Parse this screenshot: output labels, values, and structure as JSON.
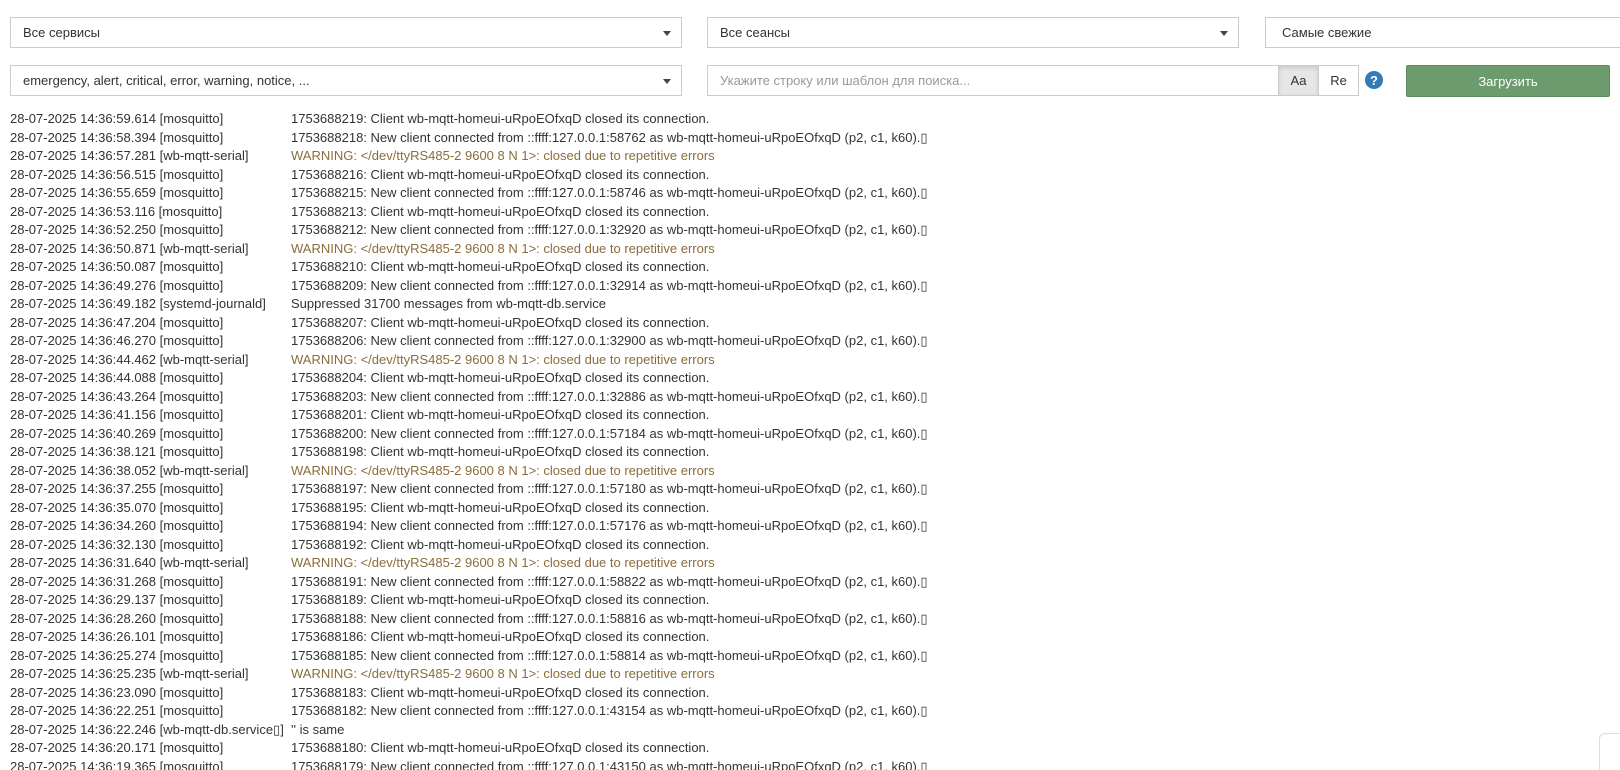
{
  "filters": {
    "services": "Все сервисы",
    "sessions": "Все сеансы",
    "order": "Самые свежие",
    "levels": "emergency, alert, critical, error, warning, notice, ..."
  },
  "search": {
    "placeholder": "Укажите строку или шаблон для поиска...",
    "case_label": "Aa",
    "regex_label": "Re",
    "help": "?"
  },
  "load_button": "Загрузить",
  "log": [
    {
      "meta": "28-07-2025 14:36:59.614 [mosquitto]",
      "msg": "1753688219: Client wb-mqtt-homeui-uRpoEOfxqD closed its connection.",
      "level": "info"
    },
    {
      "meta": "28-07-2025 14:36:58.394 [mosquitto]",
      "msg": "1753688218: New client connected from ::ffff:127.0.0.1:58762 as wb-mqtt-homeui-uRpoEOfxqD (p2, c1, k60).▯",
      "level": "info"
    },
    {
      "meta": "28-07-2025 14:36:57.281 [wb-mqtt-serial]",
      "msg": "WARNING: </dev/ttyRS485-2 9600 8 N 1>: closed due to repetitive errors",
      "level": "warning"
    },
    {
      "meta": "28-07-2025 14:36:56.515 [mosquitto]",
      "msg": "1753688216: Client wb-mqtt-homeui-uRpoEOfxqD closed its connection.",
      "level": "info"
    },
    {
      "meta": "28-07-2025 14:36:55.659 [mosquitto]",
      "msg": "1753688215: New client connected from ::ffff:127.0.0.1:58746 as wb-mqtt-homeui-uRpoEOfxqD (p2, c1, k60).▯",
      "level": "info"
    },
    {
      "meta": "28-07-2025 14:36:53.116 [mosquitto]",
      "msg": "1753688213: Client wb-mqtt-homeui-uRpoEOfxqD closed its connection.",
      "level": "info"
    },
    {
      "meta": "28-07-2025 14:36:52.250 [mosquitto]",
      "msg": "1753688212: New client connected from ::ffff:127.0.0.1:32920 as wb-mqtt-homeui-uRpoEOfxqD (p2, c1, k60).▯",
      "level": "info"
    },
    {
      "meta": "28-07-2025 14:36:50.871 [wb-mqtt-serial]",
      "msg": "WARNING: </dev/ttyRS485-2 9600 8 N 1>: closed due to repetitive errors",
      "level": "warning"
    },
    {
      "meta": "28-07-2025 14:36:50.087 [mosquitto]",
      "msg": "1753688210: Client wb-mqtt-homeui-uRpoEOfxqD closed its connection.",
      "level": "info"
    },
    {
      "meta": "28-07-2025 14:36:49.276 [mosquitto]",
      "msg": "1753688209: New client connected from ::ffff:127.0.0.1:32914 as wb-mqtt-homeui-uRpoEOfxqD (p2, c1, k60).▯",
      "level": "info"
    },
    {
      "meta": "28-07-2025 14:36:49.182 [systemd-journald]",
      "msg": "Suppressed 31700 messages from wb-mqtt-db.service",
      "level": "info"
    },
    {
      "meta": "28-07-2025 14:36:47.204 [mosquitto]",
      "msg": "1753688207: Client wb-mqtt-homeui-uRpoEOfxqD closed its connection.",
      "level": "info"
    },
    {
      "meta": "28-07-2025 14:36:46.270 [mosquitto]",
      "msg": "1753688206: New client connected from ::ffff:127.0.0.1:32900 as wb-mqtt-homeui-uRpoEOfxqD (p2, c1, k60).▯",
      "level": "info"
    },
    {
      "meta": "28-07-2025 14:36:44.462 [wb-mqtt-serial]",
      "msg": "WARNING: </dev/ttyRS485-2 9600 8 N 1>: closed due to repetitive errors",
      "level": "warning"
    },
    {
      "meta": "28-07-2025 14:36:44.088 [mosquitto]",
      "msg": "1753688204: Client wb-mqtt-homeui-uRpoEOfxqD closed its connection.",
      "level": "info"
    },
    {
      "meta": "28-07-2025 14:36:43.264 [mosquitto]",
      "msg": "1753688203: New client connected from ::ffff:127.0.0.1:32886 as wb-mqtt-homeui-uRpoEOfxqD (p2, c1, k60).▯",
      "level": "info"
    },
    {
      "meta": "28-07-2025 14:36:41.156 [mosquitto]",
      "msg": "1753688201: Client wb-mqtt-homeui-uRpoEOfxqD closed its connection.",
      "level": "info"
    },
    {
      "meta": "28-07-2025 14:36:40.269 [mosquitto]",
      "msg": "1753688200: New client connected from ::ffff:127.0.0.1:57184 as wb-mqtt-homeui-uRpoEOfxqD (p2, c1, k60).▯",
      "level": "info"
    },
    {
      "meta": "28-07-2025 14:36:38.121 [mosquitto]",
      "msg": "1753688198: Client wb-mqtt-homeui-uRpoEOfxqD closed its connection.",
      "level": "info"
    },
    {
      "meta": "28-07-2025 14:36:38.052 [wb-mqtt-serial]",
      "msg": "WARNING: </dev/ttyRS485-2 9600 8 N 1>: closed due to repetitive errors",
      "level": "warning"
    },
    {
      "meta": "28-07-2025 14:36:37.255 [mosquitto]",
      "msg": "1753688197: New client connected from ::ffff:127.0.0.1:57180 as wb-mqtt-homeui-uRpoEOfxqD (p2, c1, k60).▯",
      "level": "info"
    },
    {
      "meta": "28-07-2025 14:36:35.070 [mosquitto]",
      "msg": "1753688195: Client wb-mqtt-homeui-uRpoEOfxqD closed its connection.",
      "level": "info"
    },
    {
      "meta": "28-07-2025 14:36:34.260 [mosquitto]",
      "msg": "1753688194: New client connected from ::ffff:127.0.0.1:57176 as wb-mqtt-homeui-uRpoEOfxqD (p2, c1, k60).▯",
      "level": "info"
    },
    {
      "meta": "28-07-2025 14:36:32.130 [mosquitto]",
      "msg": "1753688192: Client wb-mqtt-homeui-uRpoEOfxqD closed its connection.",
      "level": "info"
    },
    {
      "meta": "28-07-2025 14:36:31.640 [wb-mqtt-serial]",
      "msg": "WARNING: </dev/ttyRS485-2 9600 8 N 1>: closed due to repetitive errors",
      "level": "warning"
    },
    {
      "meta": "28-07-2025 14:36:31.268 [mosquitto]",
      "msg": "1753688191: New client connected from ::ffff:127.0.0.1:58822 as wb-mqtt-homeui-uRpoEOfxqD (p2, c1, k60).▯",
      "level": "info"
    },
    {
      "meta": "28-07-2025 14:36:29.137 [mosquitto]",
      "msg": "1753688189: Client wb-mqtt-homeui-uRpoEOfxqD closed its connection.",
      "level": "info"
    },
    {
      "meta": "28-07-2025 14:36:28.260 [mosquitto]",
      "msg": "1753688188: New client connected from ::ffff:127.0.0.1:58816 as wb-mqtt-homeui-uRpoEOfxqD (p2, c1, k60).▯",
      "level": "info"
    },
    {
      "meta": "28-07-2025 14:36:26.101 [mosquitto]",
      "msg": "1753688186: Client wb-mqtt-homeui-uRpoEOfxqD closed its connection.",
      "level": "info"
    },
    {
      "meta": "28-07-2025 14:36:25.274 [mosquitto]",
      "msg": "1753688185: New client connected from ::ffff:127.0.0.1:58814 as wb-mqtt-homeui-uRpoEOfxqD (p2, c1, k60).▯",
      "level": "info"
    },
    {
      "meta": "28-07-2025 14:36:25.235 [wb-mqtt-serial]",
      "msg": "WARNING: </dev/ttyRS485-2 9600 8 N 1>: closed due to repetitive errors",
      "level": "warning"
    },
    {
      "meta": "28-07-2025 14:36:23.090 [mosquitto]",
      "msg": "1753688183: Client wb-mqtt-homeui-uRpoEOfxqD closed its connection.",
      "level": "info"
    },
    {
      "meta": "28-07-2025 14:36:22.251 [mosquitto]",
      "msg": "1753688182: New client connected from ::ffff:127.0.0.1:43154 as wb-mqtt-homeui-uRpoEOfxqD (p2, c1, k60).▯",
      "level": "info"
    },
    {
      "meta": "28-07-2025 14:36:22.246 [wb-mqtt-db.service▯]",
      "msg": "'' is same",
      "level": "info"
    },
    {
      "meta": "28-07-2025 14:36:20.171 [mosquitto]",
      "msg": "1753688180: Client wb-mqtt-homeui-uRpoEOfxqD closed its connection.",
      "level": "info"
    },
    {
      "meta": "28-07-2025 14:36:19.365 [mosquitto]",
      "msg": "1753688179: New client connected from ::ffff:127.0.0.1:43150 as wb-mqtt-homeui-uRpoEOfxqD (p2, c1, k60).▯",
      "level": "info"
    }
  ]
}
